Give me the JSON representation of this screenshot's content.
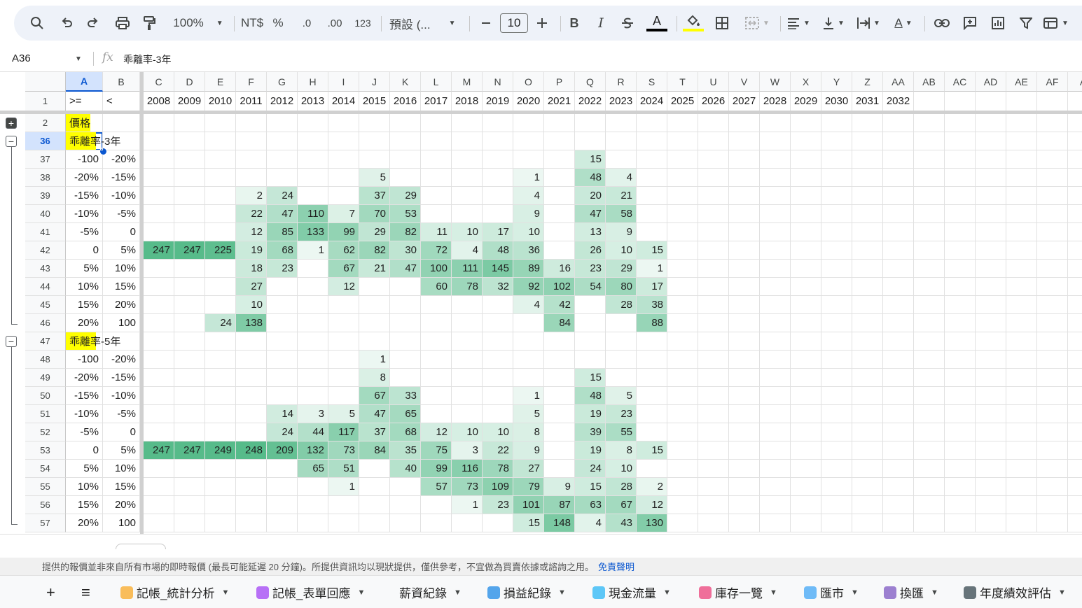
{
  "toolbar": {
    "zoom": "100%",
    "currency": "NT$",
    "percent": "%",
    "decrease_decimal": ".0",
    "increase_decimal": ".00",
    "number_format": "123",
    "font_name": "預設 (...",
    "font_size": "10",
    "bold": "B",
    "italic": "I",
    "text_color_letter": "A",
    "text_rotate_letter": "A",
    "text_color_bar": "#000000",
    "fill_color_bar": "#ffff00"
  },
  "formula_bar": {
    "cell_ref": "A36",
    "fx": "fx",
    "content": "乖離率-3年"
  },
  "columns": [
    "A",
    "B",
    "C",
    "D",
    "E",
    "F",
    "G",
    "H",
    "I",
    "J",
    "K",
    "L",
    "M",
    "N",
    "O",
    "P",
    "Q",
    "R",
    "S",
    "T",
    "U",
    "V",
    "W",
    "X",
    "Y",
    "Z",
    "AA",
    "AB",
    "AC",
    "AD",
    "AE",
    "AF",
    "A"
  ],
  "rows": [
    {
      "num": "1",
      "cells": [
        ">=",
        "<",
        "2008",
        "2009",
        "2010",
        "2011",
        "2012",
        "2013",
        "2014",
        "2015",
        "2016",
        "2017",
        "2018",
        "2019",
        "2020",
        "2021",
        "2022",
        "2023",
        "2024",
        "2025",
        "2026",
        "2027",
        "2028",
        "2029",
        "2030",
        "2031",
        "2032"
      ]
    },
    {
      "num": "2",
      "cells": [
        "價格"
      ]
    },
    {
      "num": "36",
      "cells": [
        "乖離率-3年"
      ]
    },
    {
      "num": "37",
      "cells": [
        "-100",
        "-20%",
        "",
        "",
        "",
        "",
        "",
        "",
        "",
        "",
        "",
        "",
        "",
        "",
        "",
        "",
        "15"
      ]
    },
    {
      "num": "38",
      "cells": [
        "-20%",
        "-15%",
        "",
        "",
        "",
        "",
        "",
        "",
        "",
        "5",
        "",
        "",
        "",
        "",
        "1",
        "",
        "48",
        "4"
      ]
    },
    {
      "num": "39",
      "cells": [
        "-15%",
        "-10%",
        "",
        "",
        "",
        "2",
        "24",
        "",
        "",
        "37",
        "29",
        "",
        "",
        "",
        "4",
        "",
        "20",
        "21"
      ]
    },
    {
      "num": "40",
      "cells": [
        "-10%",
        "-5%",
        "",
        "",
        "",
        "22",
        "47",
        "110",
        "7",
        "70",
        "53",
        "",
        "",
        "",
        "9",
        "",
        "47",
        "58"
      ]
    },
    {
      "num": "41",
      "cells": [
        "-5%",
        "0",
        "",
        "",
        "",
        "12",
        "85",
        "133",
        "99",
        "29",
        "82",
        "11",
        "10",
        "17",
        "10",
        "",
        "13",
        "9"
      ]
    },
    {
      "num": "42",
      "cells": [
        "0",
        "5%",
        "247",
        "247",
        "225",
        "19",
        "68",
        "1",
        "62",
        "82",
        "30",
        "72",
        "4",
        "48",
        "36",
        "",
        "26",
        "10",
        "15"
      ]
    },
    {
      "num": "43",
      "cells": [
        "5%",
        "10%",
        "",
        "",
        "",
        "18",
        "23",
        "",
        "67",
        "21",
        "47",
        "100",
        "111",
        "145",
        "89",
        "16",
        "23",
        "29",
        "1"
      ]
    },
    {
      "num": "44",
      "cells": [
        "10%",
        "15%",
        "",
        "",
        "",
        "27",
        "",
        "",
        "12",
        "",
        "",
        "60",
        "78",
        "32",
        "92",
        "102",
        "54",
        "80",
        "17"
      ]
    },
    {
      "num": "45",
      "cells": [
        "15%",
        "20%",
        "",
        "",
        "",
        "10",
        "",
        "",
        "",
        "",
        "",
        "",
        "",
        "",
        "4",
        "42",
        "",
        "28",
        "38"
      ]
    },
    {
      "num": "46",
      "cells": [
        "20%",
        "100",
        "",
        "",
        "24",
        "138",
        "",
        "",
        "",
        "",
        "",
        "",
        "",
        "",
        "",
        "84",
        "",
        "",
        "88"
      ]
    },
    {
      "num": "47",
      "cells": [
        "乖離率-5年"
      ]
    },
    {
      "num": "48",
      "cells": [
        "-100",
        "-20%",
        "",
        "",
        "",
        "",
        "",
        "",
        "",
        "1"
      ]
    },
    {
      "num": "49",
      "cells": [
        "-20%",
        "-15%",
        "",
        "",
        "",
        "",
        "",
        "",
        "",
        "8",
        "",
        "",
        "",
        "",
        "",
        "",
        "15"
      ]
    },
    {
      "num": "50",
      "cells": [
        "-15%",
        "-10%",
        "",
        "",
        "",
        "",
        "",
        "",
        "",
        "67",
        "33",
        "",
        "",
        "",
        "1",
        "",
        "48",
        "5"
      ]
    },
    {
      "num": "51",
      "cells": [
        "-10%",
        "-5%",
        "",
        "",
        "",
        "",
        "14",
        "3",
        "5",
        "47",
        "65",
        "",
        "",
        "",
        "5",
        "",
        "19",
        "23"
      ]
    },
    {
      "num": "52",
      "cells": [
        "-5%",
        "0",
        "",
        "",
        "",
        "",
        "24",
        "44",
        "117",
        "37",
        "68",
        "12",
        "10",
        "10",
        "8",
        "",
        "39",
        "55"
      ]
    },
    {
      "num": "53",
      "cells": [
        "0",
        "5%",
        "247",
        "247",
        "249",
        "248",
        "209",
        "132",
        "73",
        "84",
        "35",
        "75",
        "3",
        "22",
        "9",
        "",
        "19",
        "8",
        "15"
      ]
    },
    {
      "num": "54",
      "cells": [
        "5%",
        "10%",
        "",
        "",
        "",
        "",
        "",
        "65",
        "51",
        "",
        "40",
        "99",
        "116",
        "78",
        "27",
        "",
        "24",
        "10"
      ]
    },
    {
      "num": "55",
      "cells": [
        "10%",
        "15%",
        "",
        "",
        "",
        "",
        "",
        "",
        "1",
        "",
        "",
        "57",
        "73",
        "109",
        "79",
        "9",
        "15",
        "28",
        "2"
      ]
    },
    {
      "num": "56",
      "cells": [
        "15%",
        "20%",
        "",
        "",
        "",
        "",
        "",
        "",
        "",
        "",
        "",
        "",
        "1",
        "23",
        "101",
        "87",
        "63",
        "67",
        "12"
      ]
    },
    {
      "num": "57",
      "cells": [
        "20%",
        "100",
        "",
        "",
        "",
        "",
        "",
        "",
        "",
        "",
        "",
        "",
        "",
        "",
        "15",
        "148",
        "4",
        "43",
        "130"
      ]
    }
  ],
  "colors": {
    "heat_high": "#57bb8a",
    "heat_low": "#ffffff",
    "highlight_yellow": "#ffff00",
    "accent_blue": "#0b57d0"
  },
  "disclaimer": {
    "text": "提供的報價並非來自所有市場的即時報價 (最長可能延遲 20 分鐘)。所提供資訊均以現狀提供，僅供參考，不宜做為買賣依據或諮詢之用。",
    "link": "免責聲明"
  },
  "sheet_tabs": {
    "add": "+",
    "all_sheets": "≡",
    "tabs": [
      {
        "label": "記帳_統計分析",
        "icon": "money-face-icon"
      },
      {
        "label": "記帳_表單回應",
        "icon": "form-icon"
      },
      {
        "label": "薪資紀錄",
        "icon": ""
      },
      {
        "label": "損益紀錄",
        "icon": "floppy-icon"
      },
      {
        "label": "現金流量",
        "icon": "wave-icon"
      },
      {
        "label": "庫存一覽",
        "icon": "palette-icon"
      },
      {
        "label": "匯市",
        "icon": "chart-icon"
      },
      {
        "label": "換匯",
        "icon": "refresh-icon"
      },
      {
        "label": "年度績效評估",
        "icon": "eyes-icon"
      }
    ]
  }
}
